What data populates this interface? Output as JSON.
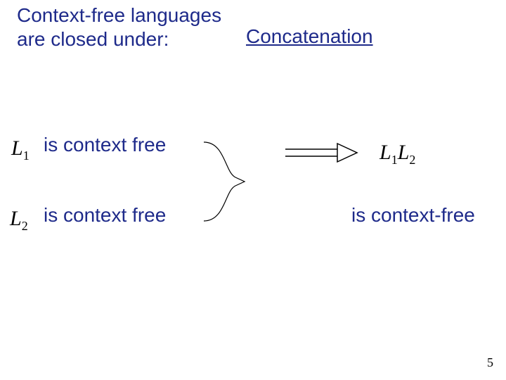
{
  "header": {
    "line1": "Context-free languages",
    "line2": "are closed under:",
    "right": "Concatenation"
  },
  "premise1": {
    "symbol_base": "L",
    "symbol_sub": "1",
    "text": "is context free"
  },
  "premise2": {
    "symbol_base": "L",
    "symbol_sub": "2",
    "text": "is context free"
  },
  "result": {
    "symbol_base1": "L",
    "symbol_sub1": "1",
    "symbol_base2": "L",
    "symbol_sub2": "2",
    "text": "is context-free"
  },
  "page_number": "5"
}
